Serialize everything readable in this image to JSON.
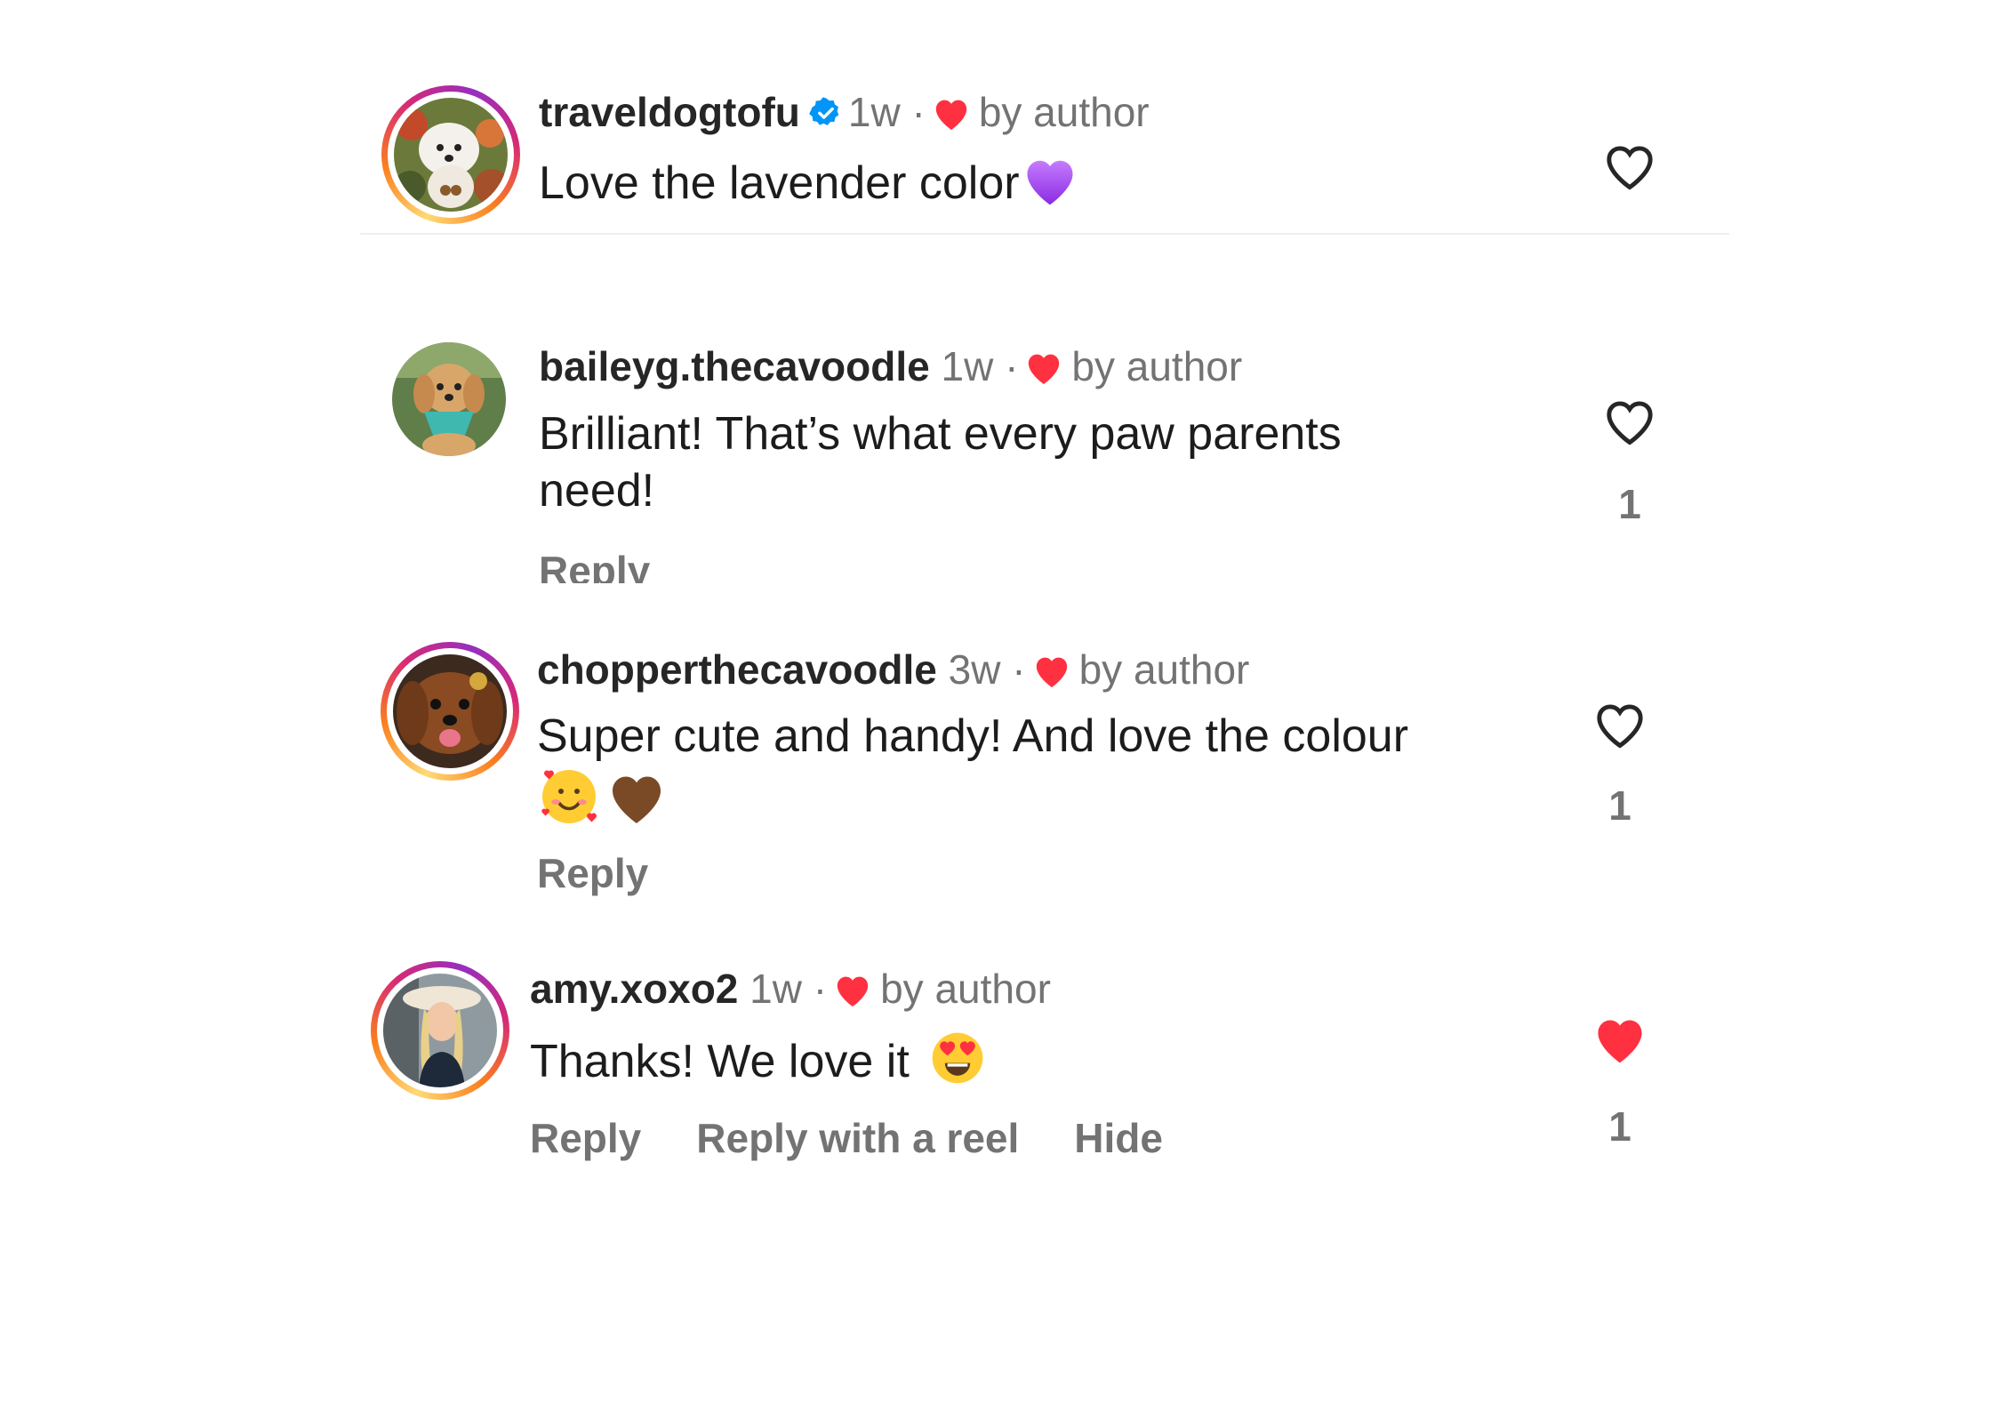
{
  "comments": [
    {
      "username": "traveldogtofu",
      "verified": true,
      "time": "1w",
      "separator": "·",
      "by_author": "by author",
      "text": "Love the lavender color",
      "emoji": "purple-heart",
      "liked": false,
      "like_count": "",
      "avatar_ring": true
    },
    {
      "username": "baileyg.thecavoodle",
      "verified": false,
      "time": "1w",
      "separator": "·",
      "by_author": "by author",
      "text_line1": "Brilliant! That’s what every paw parents",
      "text_line2": "need!",
      "reply": "Reply",
      "liked": false,
      "like_count": "1",
      "avatar_ring": false
    },
    {
      "username": "chopperthecavoodle",
      "verified": false,
      "time": "3w",
      "separator": "·",
      "by_author": "by author",
      "text": "Super cute and handy! And love the colour",
      "emojis": [
        "smiling-face-with-hearts",
        "brown-heart"
      ],
      "reply": "Reply",
      "liked": false,
      "like_count": "1",
      "avatar_ring": true
    },
    {
      "username": "amy.xoxo2",
      "verified": false,
      "time": "1w",
      "separator": "·",
      "by_author": "by author",
      "text": "Thanks! We love it",
      "emoji": "heart-eyes",
      "reply": "Reply",
      "reply_reel": "Reply with a reel",
      "hide": "Hide",
      "liked": true,
      "like_count": "1",
      "avatar_ring": true
    }
  ],
  "colors": {
    "heart_red": "#ff3040",
    "verified_blue": "#0095f6",
    "muted_text": "#737373"
  }
}
